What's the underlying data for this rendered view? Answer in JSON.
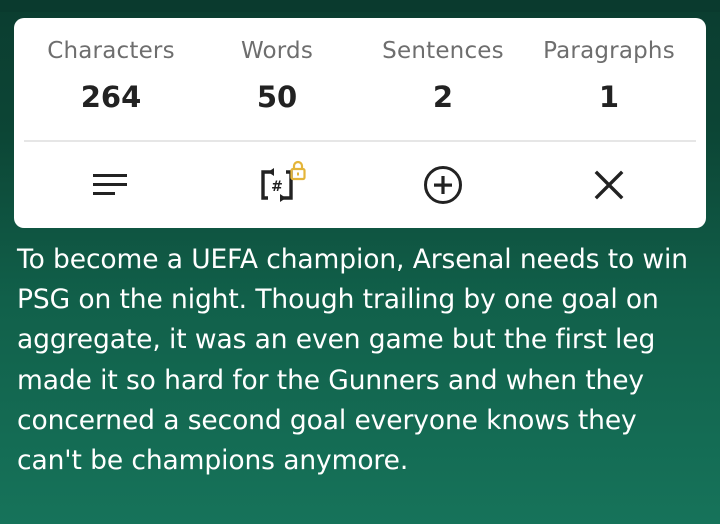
{
  "stats": [
    {
      "label": "Characters",
      "value": "264"
    },
    {
      "label": "Words",
      "value": "50"
    },
    {
      "label": "Sentences",
      "value": "2"
    },
    {
      "label": "Paragraphs",
      "value": "1"
    }
  ],
  "actions": [
    {
      "icon": "text-lines-icon"
    },
    {
      "icon": "hashtag-swap-icon",
      "locked": true
    },
    {
      "icon": "add-circle-icon"
    },
    {
      "icon": "close-icon"
    }
  ],
  "colors": {
    "lock": "#e4b53a",
    "icon": "#222222",
    "background": "#11604a"
  },
  "content": {
    "text": "To become a UEFA champion, Arsenal needs to win PSG on the night. Though trailing by one goal on aggregate, it was an even game but the first leg made it so hard for the Gunners and when they concerned a second goal everyone knows they can't be champions anymore."
  }
}
